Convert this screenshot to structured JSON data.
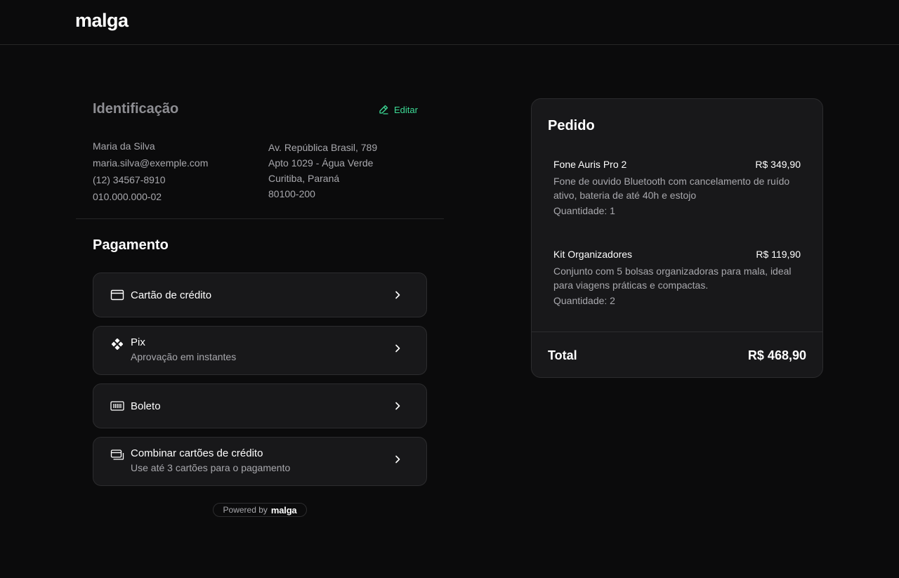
{
  "header": {
    "logo": "malga"
  },
  "identification": {
    "title": "Identificação",
    "edit_label": "Editar",
    "name": "Maria da Silva",
    "email": "maria.silva@exemple.com",
    "phone": "(12) 34567-8910",
    "document": "010.000.000-02",
    "address_line1": "Av. República Brasil, 789",
    "address_line2": "Apto 1029 - Água Verde",
    "city_state": "Curitiba, Paraná",
    "zip": "80100-200"
  },
  "payment": {
    "title": "Pagamento",
    "options": [
      {
        "label": "Cartão de crédito",
        "sub": "",
        "icon": "credit-card-icon"
      },
      {
        "label": "Pix",
        "sub": "Aprovação em instantes",
        "icon": "pix-icon"
      },
      {
        "label": "Boleto",
        "sub": "",
        "icon": "barcode-icon"
      },
      {
        "label": "Combinar cartões de crédito",
        "sub": "Use até 3 cartões para o pagamento",
        "icon": "cards-icon"
      }
    ]
  },
  "powered": {
    "prefix": "Powered by",
    "brand": "malga"
  },
  "order": {
    "title": "Pedido",
    "items": [
      {
        "name": "Fone Auris Pro 2",
        "price": "R$ 349,90",
        "description": "Fone de ouvido Bluetooth com cancelamento de ruído ativo, bateria de até 40h e estojo",
        "quantity": "Quantidade: 1"
      },
      {
        "name": "Kit Organizadores",
        "price": "R$ 119,90",
        "description": "Conjunto com 5 bolsas organizadoras para mala, ideal para viagens práticas e compactas.",
        "quantity": "Quantidade: 2"
      }
    ],
    "total_label": "Total",
    "total_value": "R$ 468,90"
  },
  "colors": {
    "background": "#0b0b0c",
    "card": "#18181a",
    "accent": "#3ddc97",
    "muted_text": "#a8a8ad"
  }
}
